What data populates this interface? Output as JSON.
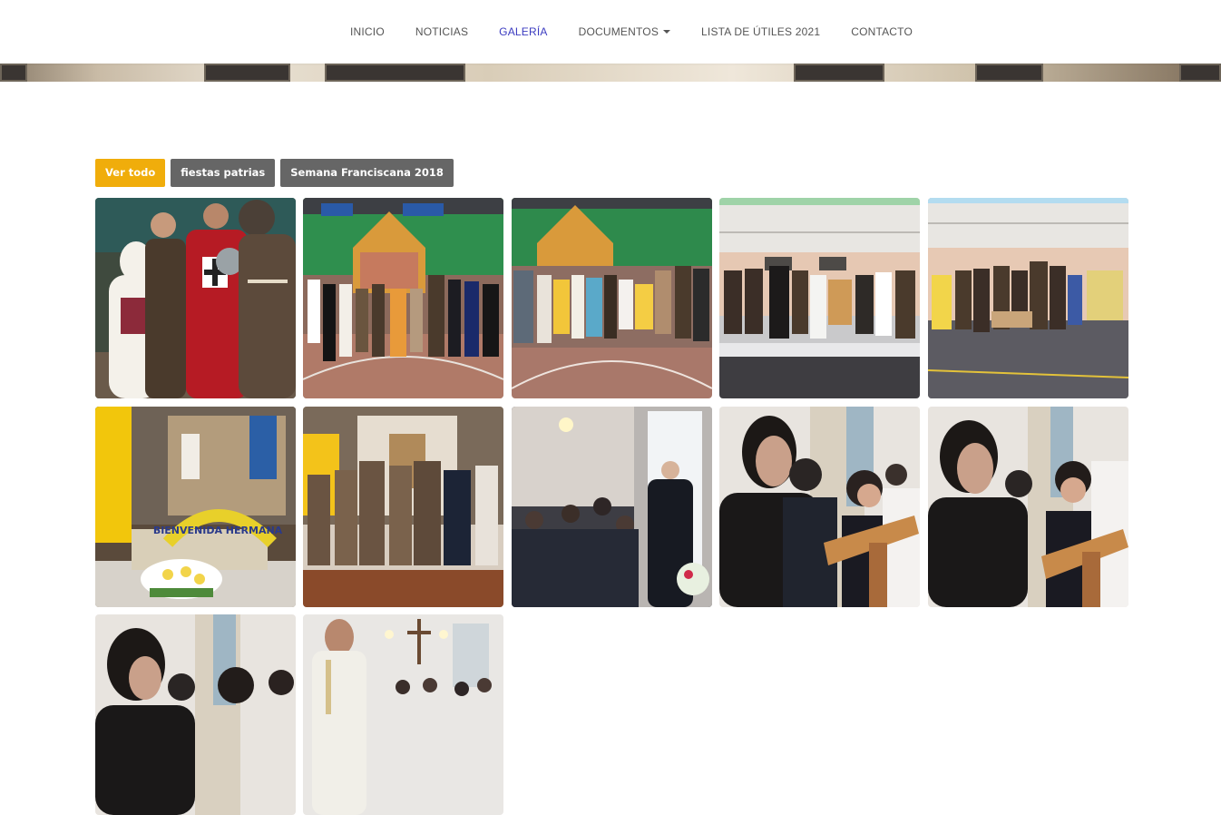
{
  "nav": {
    "items": [
      {
        "label": "INICIO",
        "active": false
      },
      {
        "label": "NOTICIAS",
        "active": false
      },
      {
        "label": "GALERÍA",
        "active": true
      },
      {
        "label": "DOCUMENTOS",
        "active": false,
        "dropdown": true
      },
      {
        "label": "LISTA DE ÚTILES 2021",
        "active": false
      },
      {
        "label": "CONTACTO",
        "active": false
      }
    ],
    "active_color": "#3b3bc0"
  },
  "filters": {
    "items": [
      {
        "label": "Ver todo",
        "active": true
      },
      {
        "label": "fiestas patrias",
        "active": false
      },
      {
        "label": "Semana Franciscana 2018",
        "active": false
      }
    ],
    "active_color": "#f0ad0b",
    "inactive_color": "#666666"
  },
  "gallery": {
    "thumbnails": [
      {
        "scene": "costume-characters-dark-bg"
      },
      {
        "scene": "gym-group-green-wall"
      },
      {
        "scene": "gym-group-green-wall-wide"
      },
      {
        "scene": "courtyard-group-outdoor"
      },
      {
        "scene": "courtyard-group-outdoor-2"
      },
      {
        "scene": "chapel-altar-bienvenida-banner",
        "banner_text": "BIENVENIDA HERMANA"
      },
      {
        "scene": "chapel-friars-ceremony"
      },
      {
        "scene": "classroom-students-nun"
      },
      {
        "scene": "reader-at-lectern"
      },
      {
        "scene": "reader-at-lectern-2"
      },
      {
        "scene": "teacher-students-chapel"
      },
      {
        "scene": "priest-mass-cross"
      }
    ]
  }
}
